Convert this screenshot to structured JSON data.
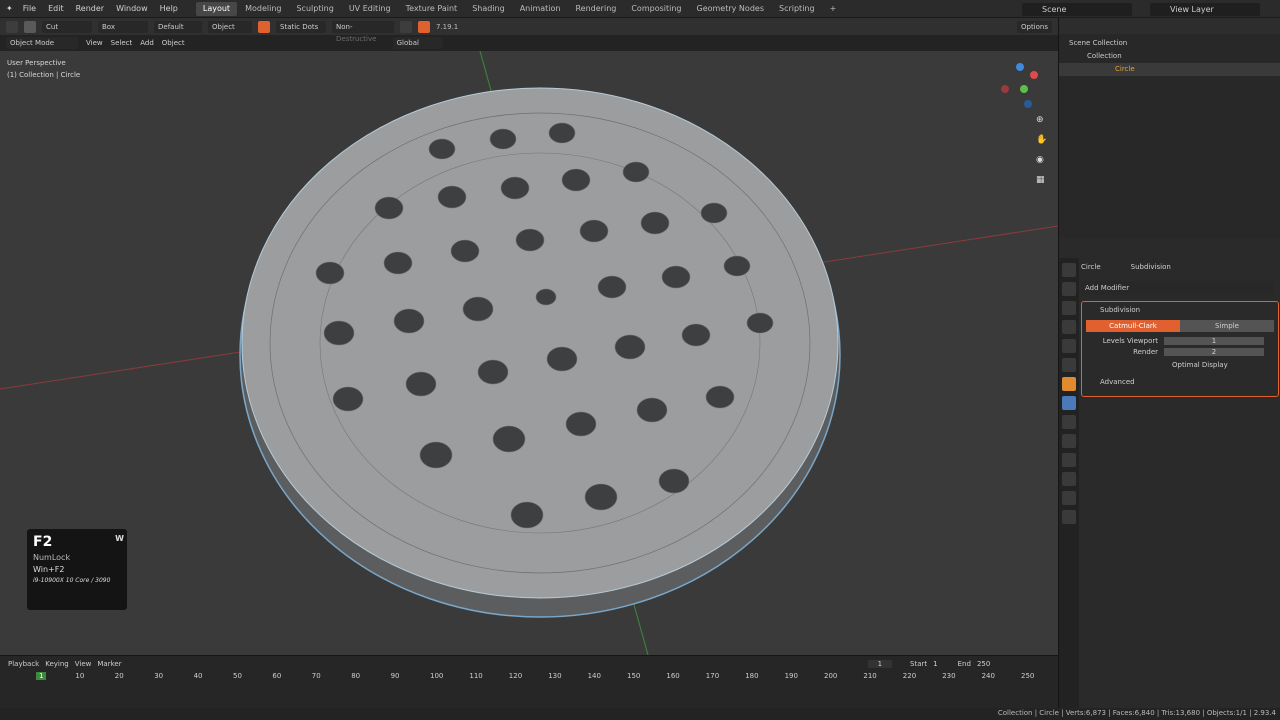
{
  "topbar": {
    "menus": [
      "File",
      "Edit",
      "Render",
      "Window",
      "Help"
    ],
    "workspaces": [
      "Layout",
      "Modeling",
      "Sculpting",
      "UV Editing",
      "Texture Paint",
      "Shading",
      "Animation",
      "Rendering",
      "Compositing",
      "Geometry Nodes",
      "Scripting"
    ],
    "active_workspace": "Layout",
    "scene": "Scene",
    "view_layer": "View Layer"
  },
  "toolbar": {
    "cut": "Cut",
    "box": "Box",
    "default": "Default",
    "object": "Object",
    "static_dots": "Static Dots",
    "non_destructive": "Non-Destructive",
    "version": "7.19.1",
    "options": "Options"
  },
  "header": {
    "mode": "Object Mode",
    "menus": [
      "View",
      "Select",
      "Add",
      "Object"
    ],
    "orientation": "Global"
  },
  "viewport": {
    "perspective": "User Perspective",
    "collection": "(1) Collection | Circle"
  },
  "key_overlay": {
    "key": "F2",
    "w": "W",
    "numlock": "NumLock",
    "combo": "Win+F2",
    "hardware": "i9-10900X 10 Core / 3090"
  },
  "outliner": {
    "scene_collection": "Scene Collection",
    "collection": "Collection",
    "object": "Circle"
  },
  "properties": {
    "object": "Circle",
    "modifier_name": "Subdivision",
    "add_modifier": "Add Modifier",
    "mod_label": "Subdivision",
    "catmull": "Catmull-Clark",
    "simple": "Simple",
    "levels_viewport_label": "Levels Viewport",
    "levels_viewport": "1",
    "render_label": "Render",
    "render": "2",
    "optimal_display": "Optimal Display",
    "advanced": "Advanced"
  },
  "timeline": {
    "menus": [
      "Playback",
      "Keying",
      "View",
      "Marker"
    ],
    "current_frame": "1",
    "start_label": "Start",
    "start": "1",
    "end_label": "End",
    "end": "250",
    "ticks": [
      "1",
      "10",
      "20",
      "30",
      "40",
      "50",
      "60",
      "70",
      "80",
      "90",
      "100",
      "110",
      "120",
      "130",
      "140",
      "150",
      "160",
      "170",
      "180",
      "190",
      "200",
      "210",
      "220",
      "230",
      "240",
      "250"
    ]
  },
  "status": "Collection | Circle | Verts:6,873 | Faces:6,840 | Tris:13,680 | Objects:1/1 | 2.93.4",
  "colors": {
    "accent": "#e0602f",
    "header": "#2b2b2b",
    "viewport": "#3a3a3a",
    "active_tab": "#474747"
  }
}
